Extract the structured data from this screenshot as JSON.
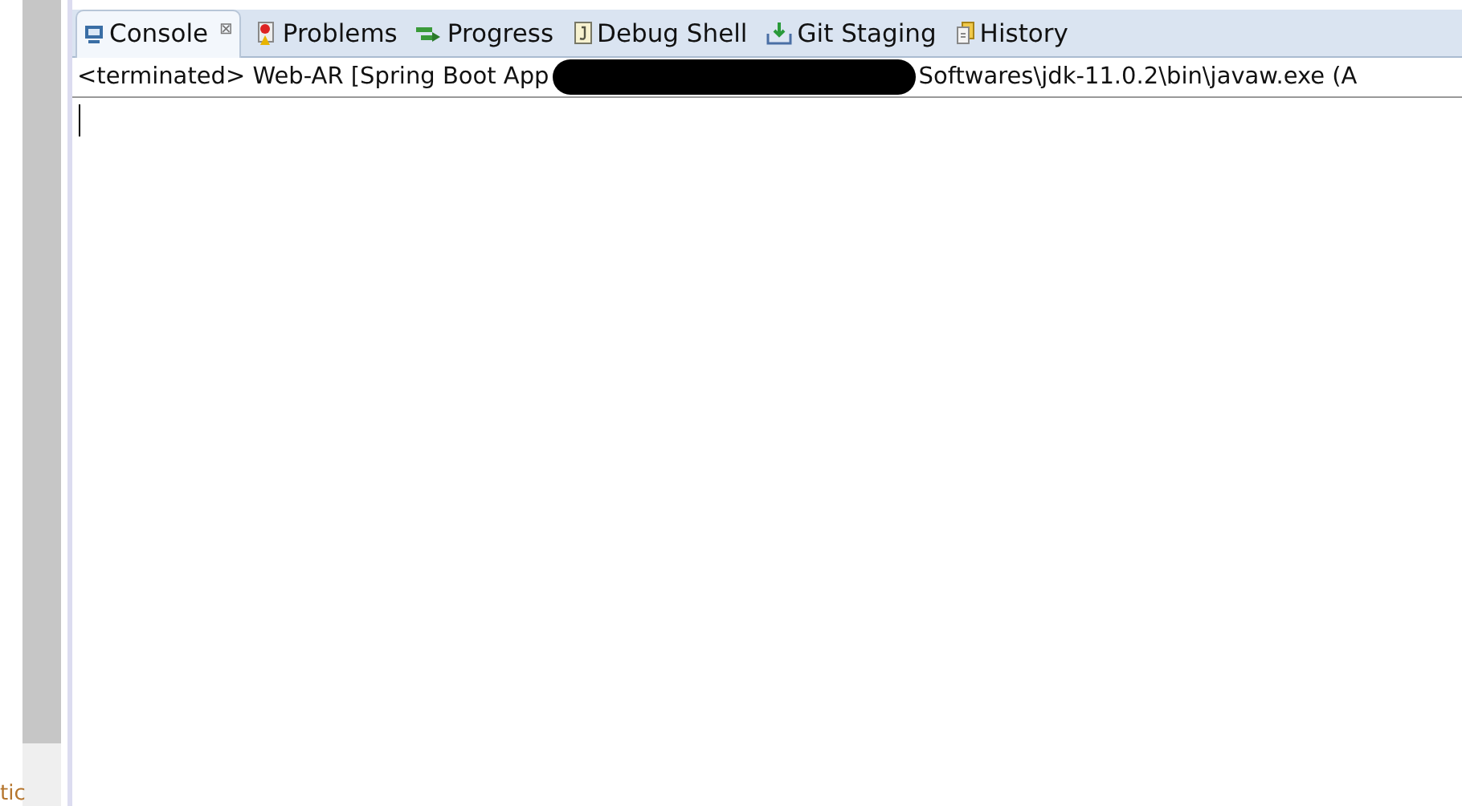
{
  "side_text": "tic",
  "tabs": [
    {
      "label": "Console",
      "kind": "console",
      "selected": true,
      "closable": true
    },
    {
      "label": "Problems",
      "kind": "problems",
      "selected": false,
      "closable": false
    },
    {
      "label": "Progress",
      "kind": "progress",
      "selected": false,
      "closable": false
    },
    {
      "label": "Debug Shell",
      "kind": "debug",
      "selected": false,
      "closable": false
    },
    {
      "label": "Git Staging",
      "kind": "git",
      "selected": false,
      "closable": false
    },
    {
      "label": "History",
      "kind": "history",
      "selected": false,
      "closable": false
    }
  ],
  "console": {
    "status_before": "<terminated> Web-AR [Spring Boot App",
    "status_after": "Softwares\\jdk-11.0.2\\bin\\javaw.exe  (A",
    "close_glyph": "⊠"
  }
}
